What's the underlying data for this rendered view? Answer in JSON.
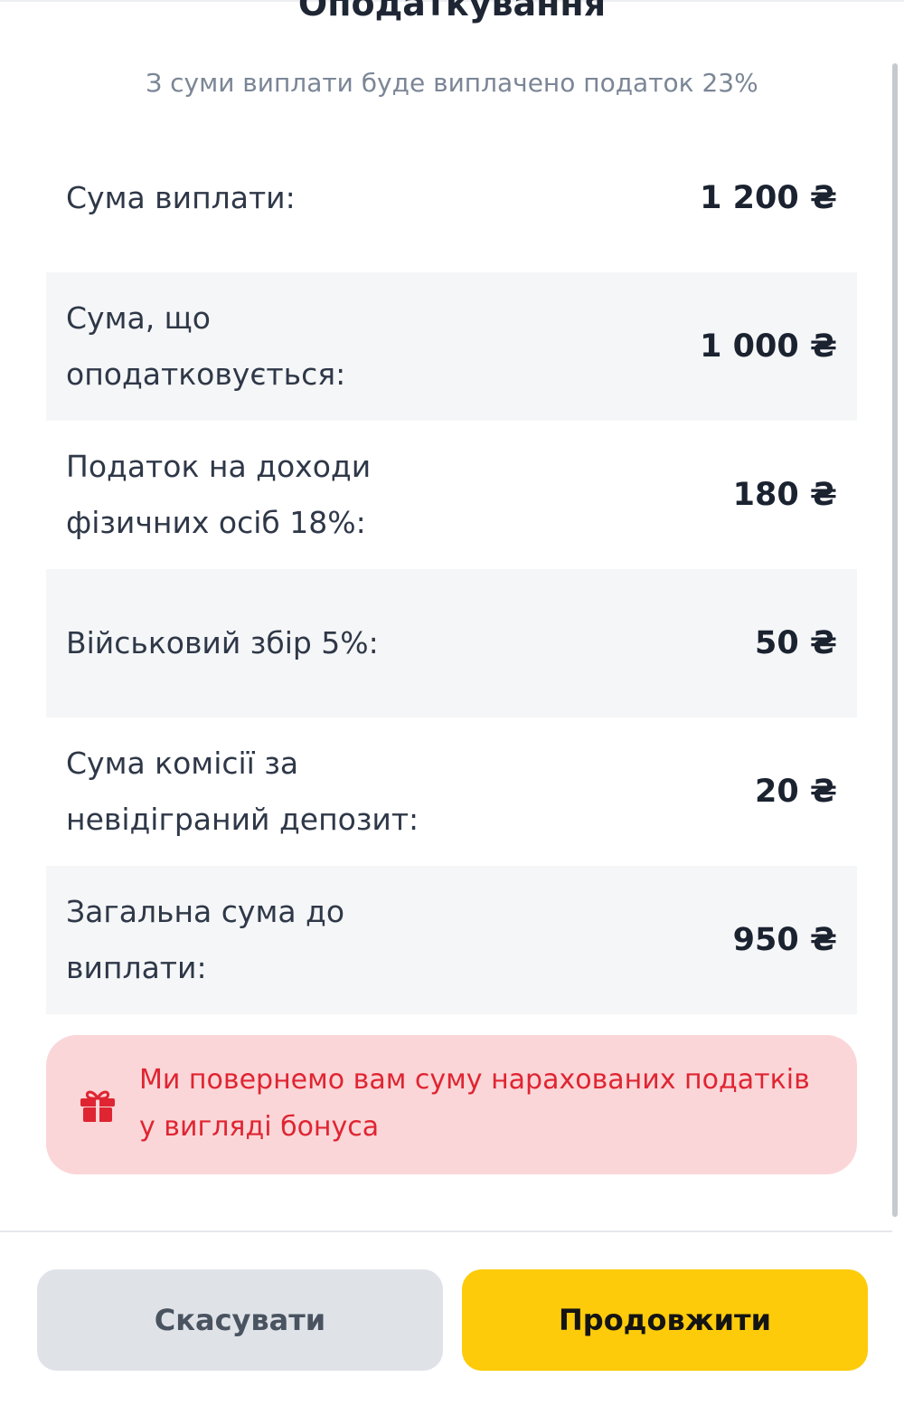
{
  "header": {
    "title": "Оподаткування",
    "subtitle": "З суми виплати буде виплачено податок 23%"
  },
  "rows": [
    {
      "label": "Сума виплати:",
      "value": "1 200 ₴"
    },
    {
      "label": "Сума, що оподатковується:",
      "value": "1 000 ₴"
    },
    {
      "label": "Податок на доходи фізичних осіб 18%:",
      "value": "180 ₴"
    },
    {
      "label": "Військовий збір 5%:",
      "value": "50 ₴"
    },
    {
      "label": "Сума комісії за невідіграний депозит:",
      "value": "20 ₴"
    },
    {
      "label": "Загальна сума до виплати:",
      "value": "950 ₴"
    }
  ],
  "notice": {
    "icon": "gift-icon",
    "text": "Ми повернемо вам суму нарахованих податків у вигляді бонуса",
    "color": "#df2532",
    "background": "#fbd6d8"
  },
  "actions": {
    "cancel_label": "Скасувати",
    "continue_label": "Продовжити",
    "continue_color": "#fdcb0a"
  }
}
